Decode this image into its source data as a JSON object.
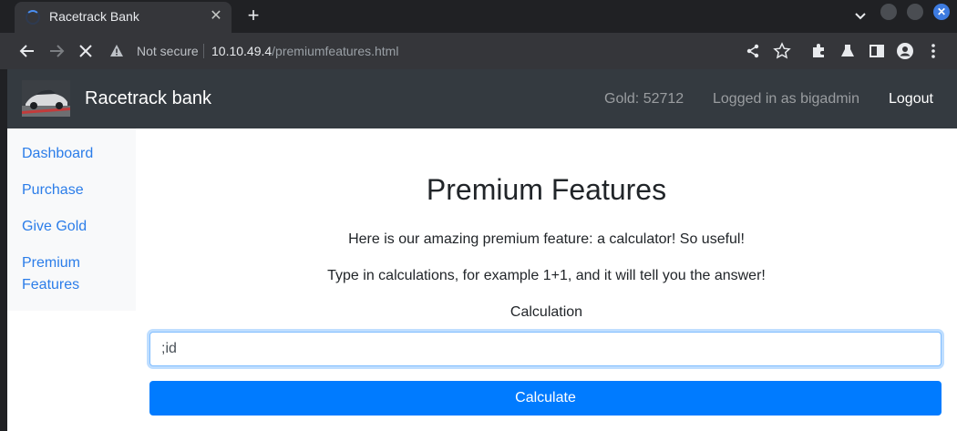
{
  "browser": {
    "tab_title": "Racetrack Bank",
    "not_secure_label": "Not secure",
    "url_host": "10.10.49.4",
    "url_path": "/premiumfeatures.html"
  },
  "navbar": {
    "brand": "Racetrack bank",
    "gold": "Gold: 52712",
    "user": "Logged in as bigadmin",
    "logout": "Logout"
  },
  "sidebar": {
    "items": [
      {
        "label": "Dashboard"
      },
      {
        "label": "Purchase"
      },
      {
        "label": "Give Gold"
      },
      {
        "label": "Premium"
      },
      {
        "label": "Features"
      }
    ]
  },
  "main": {
    "title": "Premium Features",
    "intro": "Here is our amazing premium feature: a calculator! So useful!",
    "instructions": "Type in calculations, for example 1+1, and it will tell you the answer!",
    "calc_label": "Calculation",
    "calc_value": ";id",
    "calc_button": "Calculate"
  },
  "colors": {
    "navbar_bg": "#343a40",
    "link": "#2b7de9",
    "primary": "#007bff"
  }
}
